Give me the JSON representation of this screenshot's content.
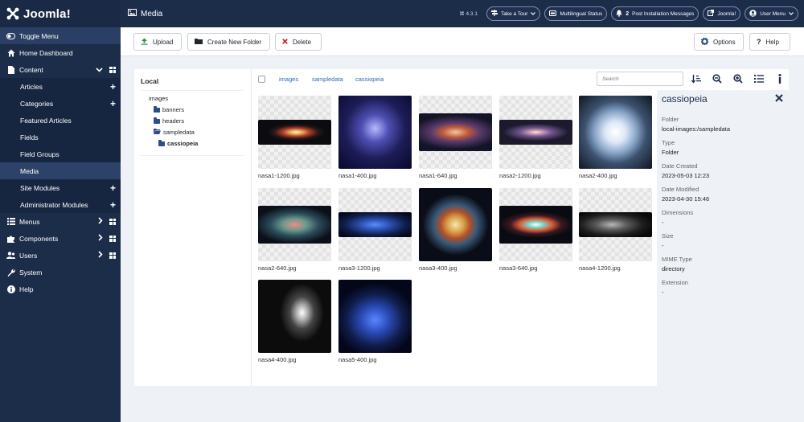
{
  "sidebar": {
    "logo": "Joomla!",
    "items": [
      {
        "label": "Toggle Menu"
      },
      {
        "label": "Home Dashboard"
      },
      {
        "label": "Content"
      },
      {
        "label": "Articles"
      },
      {
        "label": "Categories"
      },
      {
        "label": "Featured Articles"
      },
      {
        "label": "Fields"
      },
      {
        "label": "Field Groups"
      },
      {
        "label": "Media"
      },
      {
        "label": "Site Modules"
      },
      {
        "label": "Administrator Modules"
      },
      {
        "label": "Menus"
      },
      {
        "label": "Components"
      },
      {
        "label": "Users"
      },
      {
        "label": "System"
      },
      {
        "label": "Help"
      }
    ]
  },
  "header": {
    "title": "Media",
    "version": "⌘ 4.3.1",
    "take_tour": "Take a Tour",
    "multilingual": "Multilingual Status",
    "post_install_count": "2",
    "post_install": "Post Installation Messages",
    "joomla": "Joomla!",
    "user_menu": "User Menu"
  },
  "toolbar": {
    "upload": "Upload",
    "create_folder": "Create New Folder",
    "delete": "Delete",
    "options": "Options",
    "help": "Help"
  },
  "tree": {
    "title": "Local",
    "nodes": [
      "images",
      "banners",
      "headers",
      "sampledata",
      "cassiopeia"
    ]
  },
  "breadcrumb": [
    "images",
    "sampledata",
    "cassiopeia"
  ],
  "search": {
    "placeholder": "Search"
  },
  "files": [
    {
      "name": "nasa1-1200.jpg"
    },
    {
      "name": "nasa1-400.jpg"
    },
    {
      "name": "nasa1-640.jpg"
    },
    {
      "name": "nasa2-1200.jpg"
    },
    {
      "name": "nasa2-400.jpg"
    },
    {
      "name": "nasa2-640.jpg"
    },
    {
      "name": "nasa3-1200.jpg"
    },
    {
      "name": "nasa3-400.jpg"
    },
    {
      "name": "nasa3-640.jpg"
    },
    {
      "name": "nasa4-1200.jpg"
    },
    {
      "name": "nasa4-400.jpg"
    },
    {
      "name": "nasa5-400.jpg"
    }
  ],
  "info": {
    "title": "cassiopeia",
    "fields": [
      {
        "key": "Folder",
        "value": "local-images:/sampledata"
      },
      {
        "key": "Type",
        "value": "Folder"
      },
      {
        "key": "Date Created",
        "value": "2023-05-03 12:23"
      },
      {
        "key": "Date Modified",
        "value": "2023-04-30 15:46"
      },
      {
        "key": "Dimensions",
        "value": "-"
      },
      {
        "key": "Size",
        "value": "-"
      },
      {
        "key": "MIME Type",
        "value": "directory"
      },
      {
        "key": "Extension",
        "value": "-"
      }
    ]
  },
  "colors": {
    "sidebar": "#1c2d4a",
    "accent": "#2a69b8",
    "delete": "#c52827"
  }
}
